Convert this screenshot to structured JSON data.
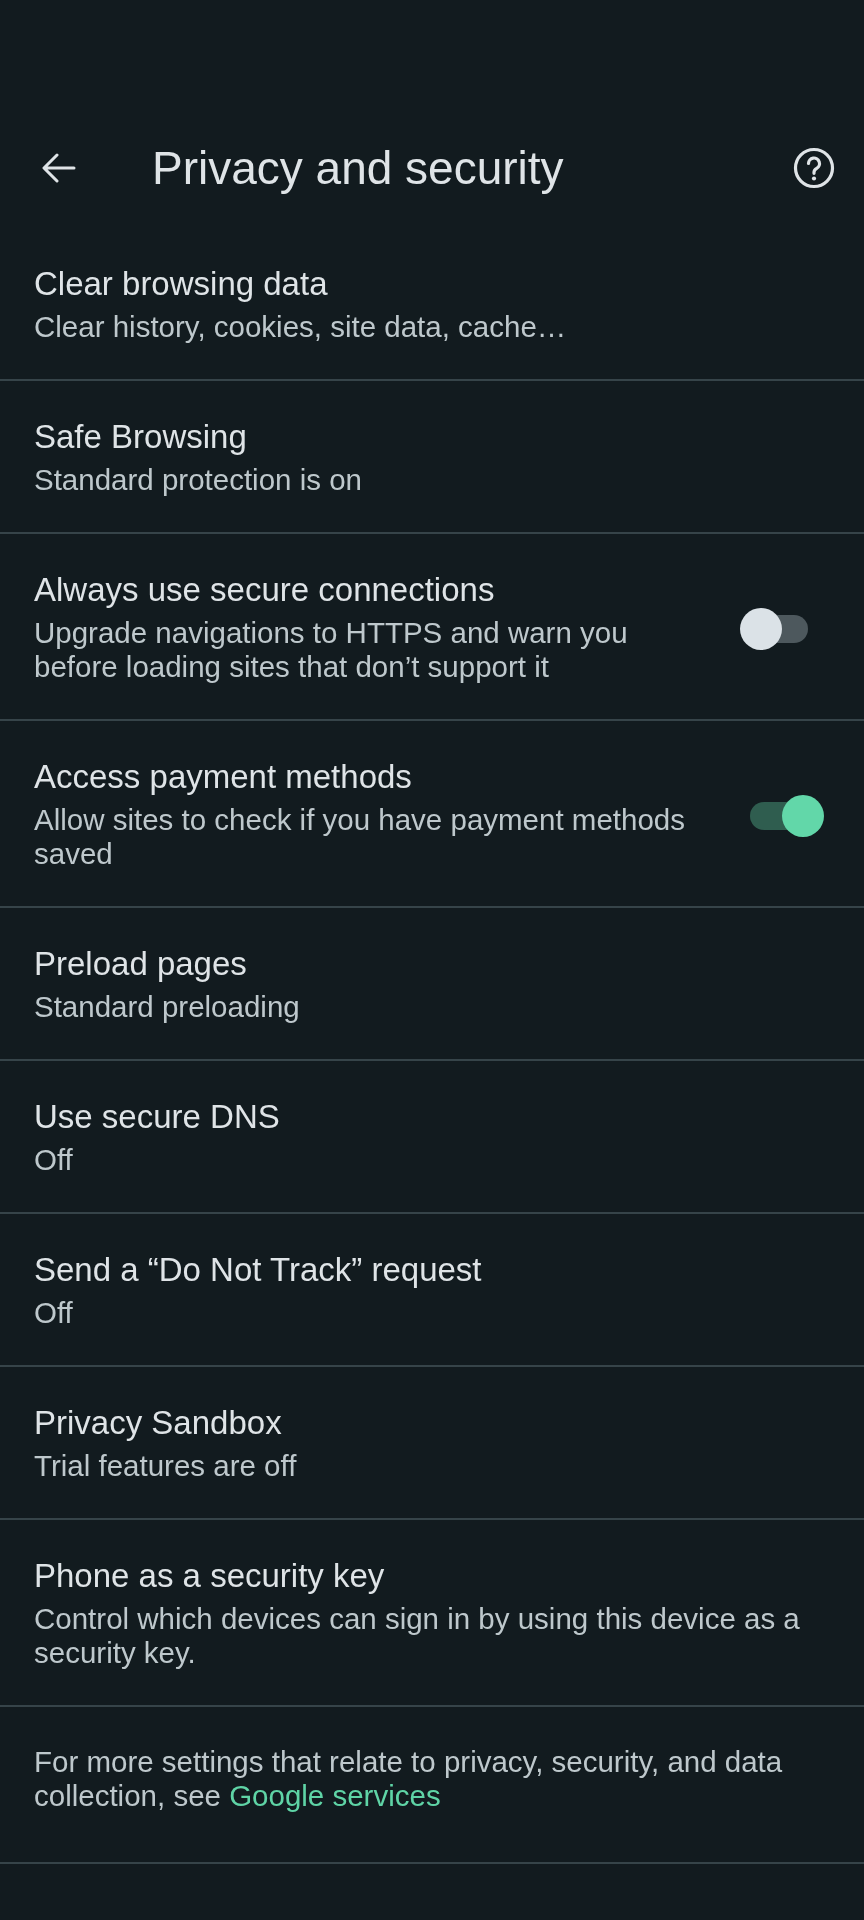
{
  "header": {
    "title": "Privacy and security"
  },
  "settings": [
    {
      "kind": "link",
      "title": "Clear browsing data",
      "subtitle": "Clear history, cookies, site data, cache…"
    },
    {
      "kind": "link",
      "title": "Safe Browsing",
      "subtitle": "Standard protection is on"
    },
    {
      "kind": "toggle",
      "title": "Always use secure connections",
      "subtitle": "Upgrade navigations to HTTPS and warn you before loading sites that don’t support it",
      "on": false
    },
    {
      "kind": "toggle",
      "title": "Access payment methods",
      "subtitle": "Allow sites to check if you have payment methods saved",
      "on": true
    },
    {
      "kind": "link",
      "title": "Preload pages",
      "subtitle": "Standard preloading"
    },
    {
      "kind": "link",
      "title": "Use secure DNS",
      "subtitle": "Off"
    },
    {
      "kind": "link",
      "title": "Send a “Do Not Track” request",
      "subtitle": "Off"
    },
    {
      "kind": "link",
      "title": "Privacy Sandbox",
      "subtitle": "Trial features are off"
    },
    {
      "kind": "link",
      "title": "Phone as a security key",
      "subtitle": "Control which devices can sign in by using this device as a security key."
    }
  ],
  "footer": {
    "text": "For more settings that relate to privacy, security, and data collection, see",
    "link": "Google services"
  }
}
